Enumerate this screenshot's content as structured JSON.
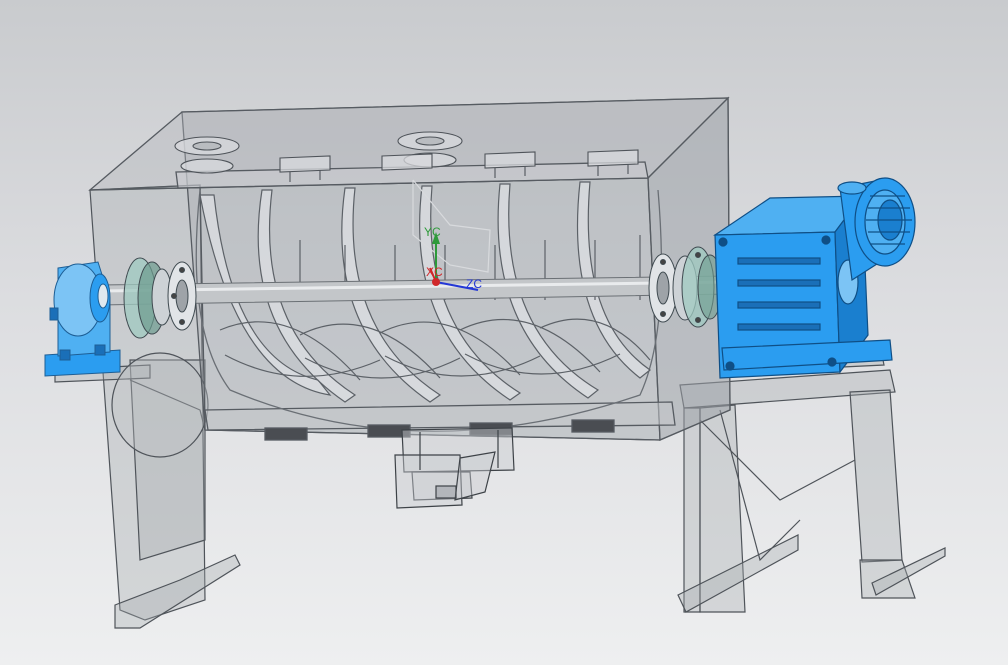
{
  "viewport": {
    "background_top": "#c9cbce",
    "background_bottom": "#eeeff0"
  },
  "colors": {
    "shell_fill": "#a9aeb3",
    "shell_stroke": "#5b6066",
    "component_blue": "#2b9df0",
    "component_blue_dark": "#1a6fb8",
    "shaft": "#b9bcbf",
    "axis_x": "#d0282a",
    "axis_y": "#2e9a3a",
    "axis_z": "#2337d6"
  },
  "triad": {
    "y_label": "YC",
    "x_label": "XC",
    "z_label": "ZC"
  },
  "parts": [
    "mixer-trough",
    "ribbon-agitator",
    "drive-shaft",
    "left-bearing-block",
    "left-coupling",
    "right-coupling",
    "gear-reducer",
    "electric-motor",
    "left-support-frame",
    "right-support-frame",
    "discharge-valve",
    "inlet-ports"
  ]
}
